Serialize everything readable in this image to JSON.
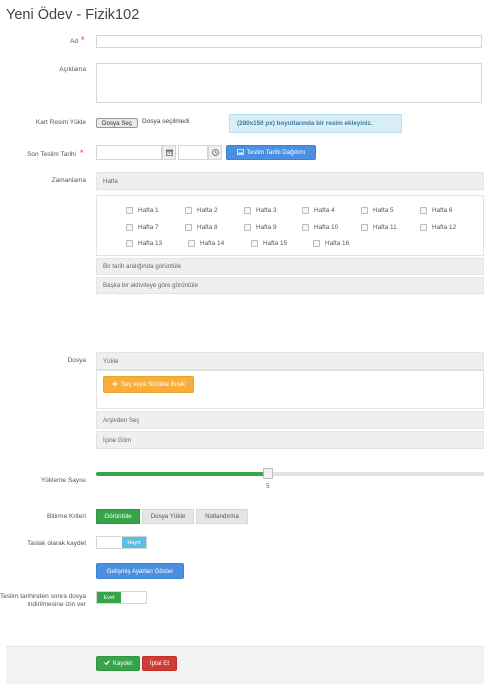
{
  "page": {
    "title": "Yeni Ödev - Fizik102"
  },
  "form": {
    "name": {
      "label": "Ad",
      "value": ""
    },
    "description": {
      "label": "Açıklama",
      "value": ""
    },
    "card_image": {
      "label": "Kart Resim Yükle",
      "button": "Dosya Seç",
      "status": "Dosya seçilmedi",
      "hint": "(280x150 px) boyutlarında bir resim ekleyiniz."
    },
    "due_date": {
      "label": "Son Teslim Tarihi",
      "date_value": "",
      "time_value": "",
      "distribution_button": "Teslim Tarihi Dağılımı"
    },
    "scheduling": {
      "label": "Zamanlama",
      "week_panel": "Hafta",
      "weeks": [
        "Hafta 1",
        "Hafta 2",
        "Hafta 3",
        "Hafta 4",
        "Hafta 5",
        "Hafta 6",
        "Hafta 7",
        "Hafta 8",
        "Hafta 9",
        "Hafta 10",
        "Hafta 11",
        "Hafta 12",
        "Hafta 13",
        "Hafta 14",
        "Hafta 15",
        "Hafta 16"
      ],
      "date_range_panel": "Bir tarih aralığında görüntüle",
      "after_activity_panel": "Başka bir aktiviteye göre görüntüle"
    },
    "file": {
      "label": "Dosya",
      "upload_panel": "Yükle",
      "upload_button": "Seç veya Sürükle Bırak",
      "archive_panel": "Arşivden Seç",
      "embed_panel": "İçine Göm"
    },
    "upload_count": {
      "label": "Yükleme Sayısı",
      "value": 5,
      "min": 1,
      "max": 10
    },
    "completion": {
      "label": "Bitirme Kriteri",
      "options": [
        "Görüntüle",
        "Dosya Yükle",
        "Notlandırma"
      ],
      "selected": "Görüntüle"
    },
    "draft": {
      "label": "Taslak olarak kaydet",
      "toggle_text": "Hayır"
    },
    "advanced_button": "Gelişmiş Ayarları Göster",
    "late_download": {
      "label": "Teslim tarihinden sonra dosya indirilmesine izin ver",
      "toggle_text": "Evet"
    }
  },
  "footer": {
    "save": "Kaydet",
    "cancel": "İptal Et"
  },
  "colors": {
    "primary": "#4a90e2",
    "success": "#37a44a",
    "danger": "#d23b33",
    "warning": "#f7ae3b",
    "required": "#d9363e"
  },
  "icons": {
    "calendar": "calendar-icon",
    "clock": "clock-icon",
    "image": "image-icon",
    "plus": "plus-icon",
    "check": "check-icon"
  }
}
